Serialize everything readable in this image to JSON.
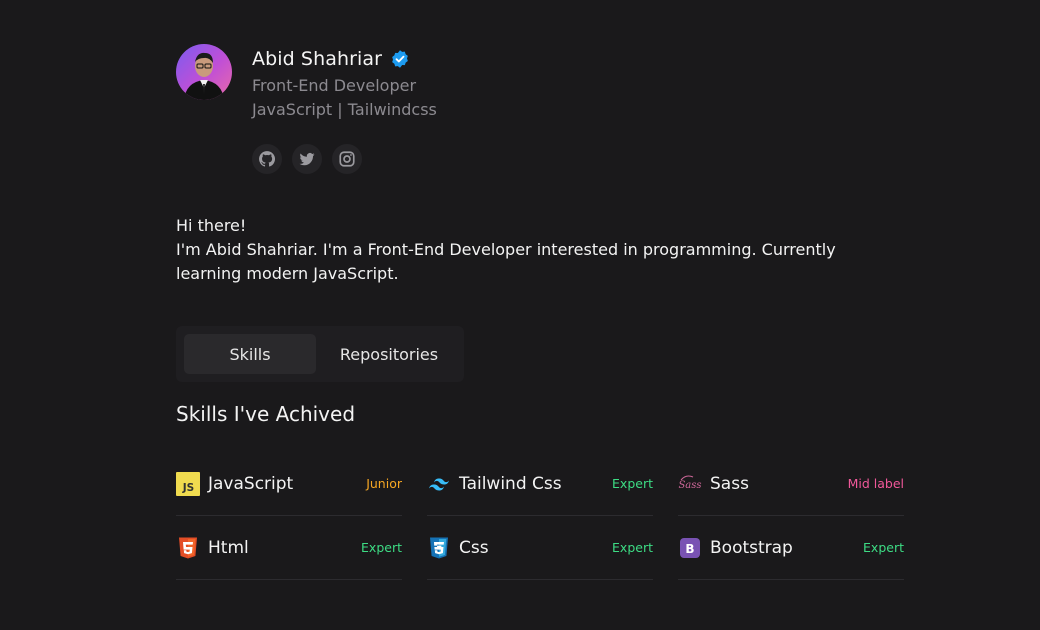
{
  "profile": {
    "name": "Abid Shahriar",
    "role": "Front-End Developer",
    "stack": "JavaScript | Tailwindcss",
    "socials": [
      "github-icon",
      "twitter-icon",
      "instagram-icon"
    ]
  },
  "bio": {
    "greeting": "Hi there!",
    "text": "I'm Abid Shahriar. I'm a Front-End Developer interested in programming. Currently learning modern JavaScript."
  },
  "tabs": [
    {
      "label": "Skills",
      "active": true
    },
    {
      "label": "Repositories",
      "active": false
    }
  ],
  "skills_section": {
    "title": "Skills I've Achived",
    "items": [
      {
        "name": "JavaScript",
        "level": "Junior",
        "level_color": "#f5a623",
        "icon": "javascript-icon"
      },
      {
        "name": "Tailwind Css",
        "level": "Expert",
        "level_color": "#3ddc84",
        "icon": "tailwind-icon"
      },
      {
        "name": "Sass",
        "level": "Mid label",
        "level_color": "#f0589a",
        "icon": "sass-icon"
      },
      {
        "name": "Html",
        "level": "Expert",
        "level_color": "#3ddc84",
        "icon": "html-icon"
      },
      {
        "name": "Css",
        "level": "Expert",
        "level_color": "#3ddc84",
        "icon": "css-icon"
      },
      {
        "name": "Bootstrap",
        "level": "Expert",
        "level_color": "#3ddc84",
        "icon": "bootstrap-icon"
      }
    ]
  },
  "colors": {
    "background": "#1a191b",
    "verified": "#1d9bf0",
    "muted_text": "#8c8a90"
  }
}
